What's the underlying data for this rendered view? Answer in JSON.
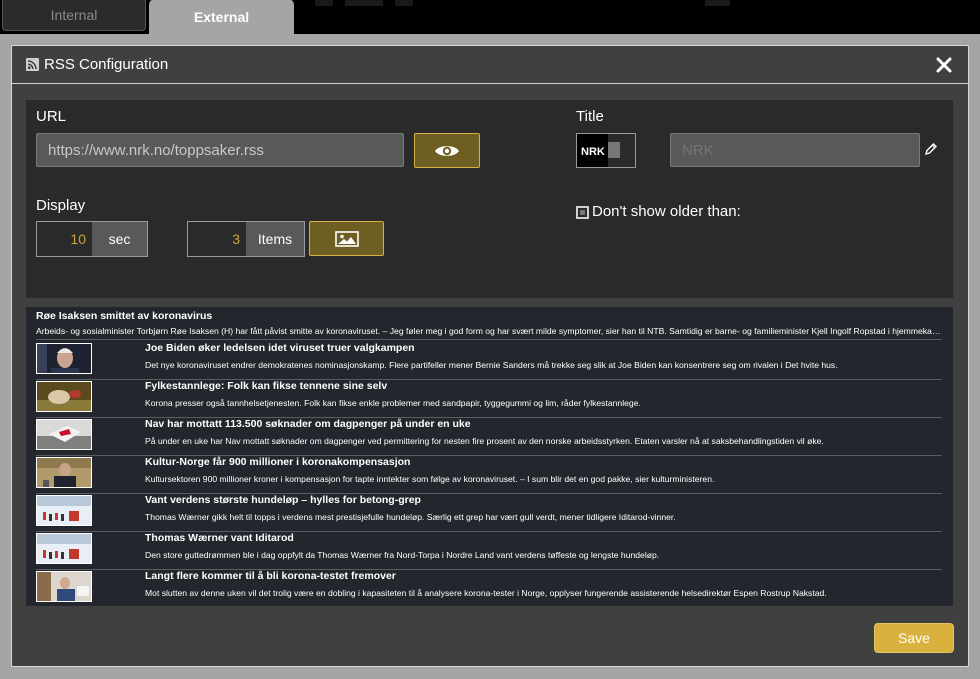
{
  "tabs": [
    {
      "label": "Internal"
    },
    {
      "label": "External"
    }
  ],
  "modal": {
    "title": "RSS Configuration",
    "close_icon": "close-icon",
    "rss_icon": "rss-feed-icon"
  },
  "config": {
    "url_label": "URL",
    "url_value": "https://www.nrk.no/toppsaker.rss",
    "preview_icon": "eye-icon",
    "title_label": "Title",
    "title_logo_text": "NRK",
    "title_placeholder": "NRK",
    "edit_icon": "pencil-icon",
    "display_label": "Display",
    "seconds_value": "10",
    "seconds_unit": "sec",
    "items_value": "3",
    "items_unit": "Items",
    "image_icon": "image-icon",
    "older_than_label": "Don't show older than:",
    "older_than_checked": false
  },
  "feed": {
    "top": {
      "title": "Røe Isaksen smittet av koronavirus",
      "desc": "Arbeids- og sosialminister Torbjørn Røe Isaksen (H) har fått påvist smitte av koronaviruset. – Jeg føler meg i god form og har svært milde symptomer, sier han til NTB. Samtidig er barne- og familieminister Kjell Ingolf Ropstad i hjemmekarantene."
    },
    "items": [
      {
        "title": "Joe Biden øker ledelsen idet viruset truer valgkampen",
        "desc": "Det nye koronaviruset endrer demokratenes nominasjonskamp. Flere partifeller mener Bernie Sanders må trekke seg slik at Joe Biden kan konsentrere seg om rivalen i Det hvite hus.",
        "thumb": "biden"
      },
      {
        "title": "Fylkestannlege: Folk kan fikse tennene sine selv",
        "desc": "Korona presser også tannhelsetjenesten. Folk kan fikse enkle problemer med sandpapir, tyggegummi og lim, råder fylkestannlege.",
        "thumb": "teeth"
      },
      {
        "title": "Nav har mottatt 113.500 søknader om dagpenger på under en uke",
        "desc": "På under en uke har Nav mottatt søknader om dagpenger ved permittering for nesten fire prosent av den norske arbeidsstyrken. Etaten varsler nå at saksbehandlingstiden vil øke.",
        "thumb": "nav"
      },
      {
        "title": "Kultur-Norge får 900 millioner i koronakompensasjon",
        "desc": "Kultursektoren 900 millioner kroner i kompensasjon for tapte inntekter som følge av koronaviruset. – I sum blir det en god pakke, sier kulturministeren.",
        "thumb": "kultur"
      },
      {
        "title": "Vant verdens største hundeløp – hylles for betong-grep",
        "desc": "Thomas Wærner gikk helt til topps i verdens mest prestisjefulle hundeløp. Særlig ett grep har vært gull verdt, mener tidligere Iditarod-vinner.",
        "thumb": "dogs"
      },
      {
        "title": "Thomas Wærner vant Iditarod",
        "desc": "Den store guttedrømmen ble i dag oppfylt da Thomas Wærner fra Nord-Torpa i Nordre Land vant verdens tøffeste og lengste hundeløp.",
        "thumb": "dogs"
      },
      {
        "title": "Langt flere kommer til å bli korona-testet fremover",
        "desc": "Mot slutten av denne uken vil det trolig være en dobling i kapasiteten til å analysere korona-tester i Norge, opplyser fungerende assisterende helsedirektør Espen Rostrup Nakstad.",
        "thumb": "test"
      }
    ]
  },
  "footer": {
    "save_label": "Save"
  },
  "colors": {
    "accent": "#d8b13e",
    "accent_dark": "#6f5e22",
    "panel": "#2a2a2a",
    "modal": "#404040",
    "feed_bg": "#23272d"
  }
}
